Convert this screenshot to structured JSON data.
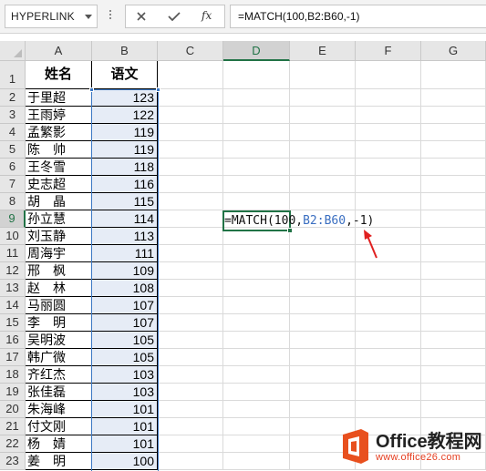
{
  "formula_bar": {
    "name_box": "HYPERLINK",
    "cancel_symbol": "✕",
    "enter_symbol": "✓",
    "fx_label": "fx",
    "formula": "=MATCH(100,B2:B60,-1)"
  },
  "columns": [
    "A",
    "B",
    "C",
    "D",
    "E",
    "F",
    "G"
  ],
  "selected_column": "D",
  "selected_row": 9,
  "headers": {
    "name": "姓名",
    "score": "语文"
  },
  "rows": [
    {
      "row": "1"
    },
    {
      "row": "2",
      "name": "于里超",
      "score": "123"
    },
    {
      "row": "3",
      "name": "王雨婷",
      "score": "122"
    },
    {
      "row": "4",
      "name": "孟繁影",
      "score": "119"
    },
    {
      "row": "5",
      "name": "陈　帅",
      "score": "119"
    },
    {
      "row": "6",
      "name": "王冬雪",
      "score": "118"
    },
    {
      "row": "7",
      "name": "史志超",
      "score": "116"
    },
    {
      "row": "8",
      "name": "胡　晶",
      "score": "115"
    },
    {
      "row": "9",
      "name": "孙立慧",
      "score": "114"
    },
    {
      "row": "10",
      "name": "刘玉静",
      "score": "113"
    },
    {
      "row": "11",
      "name": "周海宇",
      "score": "111"
    },
    {
      "row": "12",
      "name": "邢　枫",
      "score": "109"
    },
    {
      "row": "13",
      "name": "赵　林",
      "score": "108"
    },
    {
      "row": "14",
      "name": "马丽圆",
      "score": "107"
    },
    {
      "row": "15",
      "name": "李　明",
      "score": "107"
    },
    {
      "row": "16",
      "name": "吴明波",
      "score": "105"
    },
    {
      "row": "17",
      "name": "韩广微",
      "score": "105"
    },
    {
      "row": "18",
      "name": "齐红杰",
      "score": "103"
    },
    {
      "row": "19",
      "name": "张佳磊",
      "score": "103"
    },
    {
      "row": "20",
      "name": "朱海峰",
      "score": "101"
    },
    {
      "row": "21",
      "name": "付文刚",
      "score": "101"
    },
    {
      "row": "22",
      "name": "杨　婧",
      "score": "101"
    },
    {
      "row": "23",
      "name": "姜　明",
      "score": "100"
    }
  ],
  "active_cell_editor": {
    "prefix": "=MATCH(100,",
    "ref": "B2:B60",
    "suffix": ",-1)"
  },
  "watermark": {
    "brand": "Office教程网",
    "url": "www.office26.com"
  },
  "colors": {
    "accent_green": "#217346",
    "selection_blue": "#3c78c3",
    "reference_blue": "#3b6fc1",
    "arrow_red": "#e02020",
    "watermark_orange": "#e8501e"
  }
}
